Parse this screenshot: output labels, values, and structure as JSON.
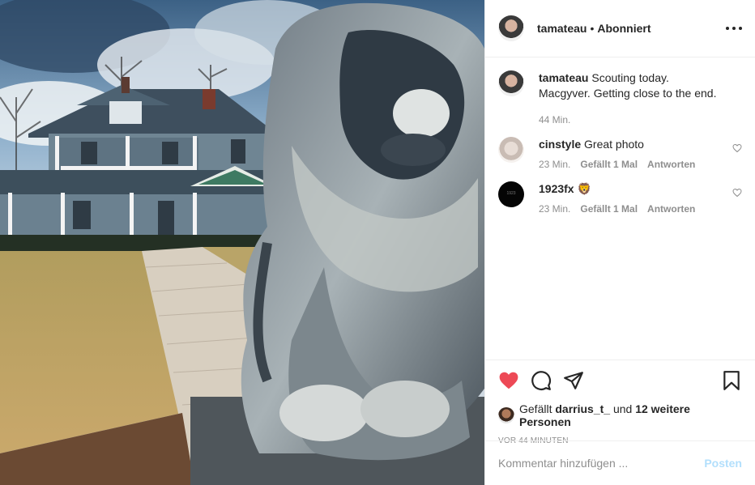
{
  "post": {
    "username": "tamateau",
    "separator": "•",
    "follow_status": "Abonniert",
    "image_alt": "lion statue photo",
    "caption": {
      "username": "tamateau",
      "text": "Scouting today. Macgyver. Getting close to the end.",
      "time": "44 Min."
    },
    "comments": [
      {
        "username": "cinstyle",
        "text": "Great photo",
        "time": "23 Min.",
        "likes": "Gefällt 1 Mal",
        "reply": "Antworten"
      },
      {
        "username": "1923fx",
        "text": "🦁",
        "time": "23 Min.",
        "likes": "Gefällt 1 Mal",
        "reply": "Antworten"
      }
    ],
    "likes": {
      "prefix": "Gefällt",
      "user": "darrius_t_",
      "middle": "und",
      "others": "12 weitere Personen"
    },
    "timestamp": "VOR 44 MINUTEN",
    "comment_input": {
      "placeholder": "Kommentar hinzufügen ..."
    },
    "post_button": "Posten",
    "avatar_19_text": "1923"
  },
  "colors": {
    "like_red": "#ed4956",
    "post_disabled": "#b2dffc",
    "muted": "#8e8e8e"
  }
}
